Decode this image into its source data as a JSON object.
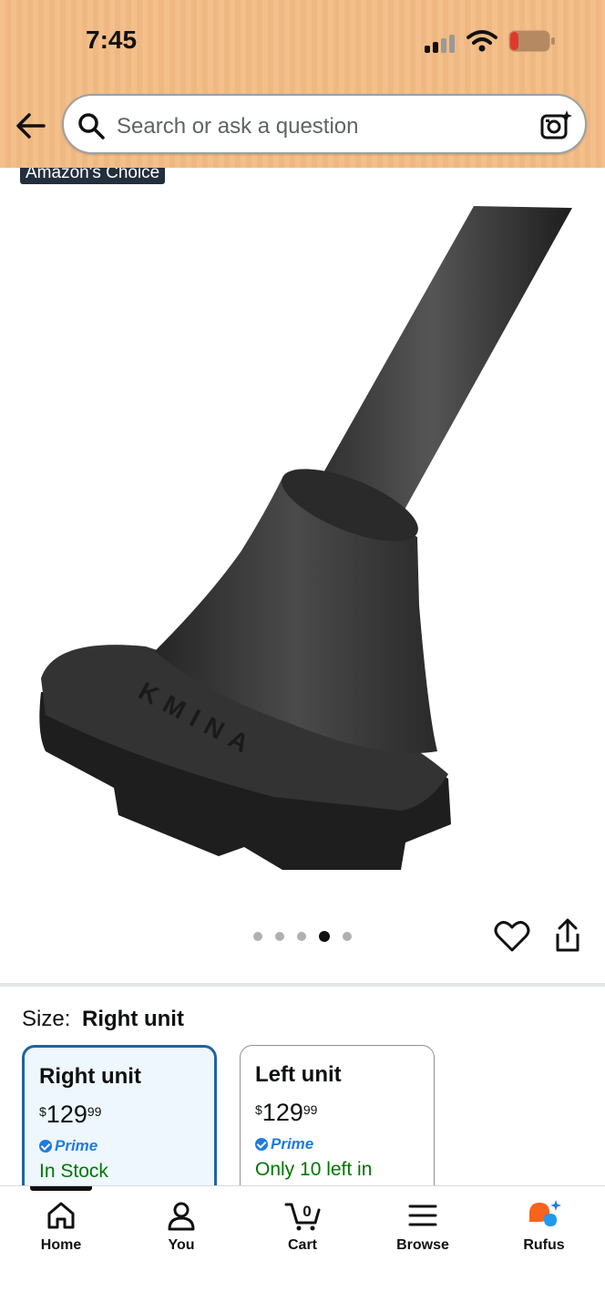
{
  "status_bar": {
    "time": "7:45"
  },
  "search": {
    "placeholder": "Search or ask a question"
  },
  "badge": {
    "label": "Amazon's Choice"
  },
  "carousel": {
    "total_images": 5,
    "active_index": 3
  },
  "size_selector": {
    "label": "Size:",
    "selected_value": "Right unit",
    "options": [
      {
        "title": "Right unit",
        "currency": "$",
        "price_whole": "129",
        "price_fraction": "99",
        "prime": "Prime",
        "stock": "In Stock",
        "selected": true
      },
      {
        "title": "Left unit",
        "currency": "$",
        "price_whole": "129",
        "price_fraction": "99",
        "prime": "Prime",
        "stock": "Only 10 left in",
        "selected": false
      }
    ]
  },
  "bottom_nav": {
    "items": [
      {
        "label": "Home",
        "icon": "home-icon"
      },
      {
        "label": "You",
        "icon": "person-icon"
      },
      {
        "label": "Cart",
        "icon": "cart-icon",
        "count": "0"
      },
      {
        "label": "Browse",
        "icon": "menu-icon"
      },
      {
        "label": "Rufus",
        "icon": "rufus-icon"
      }
    ]
  },
  "colors": {
    "header": "#f3bf8a",
    "selected_border": "#2162a1",
    "prime_blue": "#1f7be0",
    "stock_green": "#007600",
    "rufus_orange": "#f7641b",
    "rufus_blue": "#1f9af0"
  }
}
